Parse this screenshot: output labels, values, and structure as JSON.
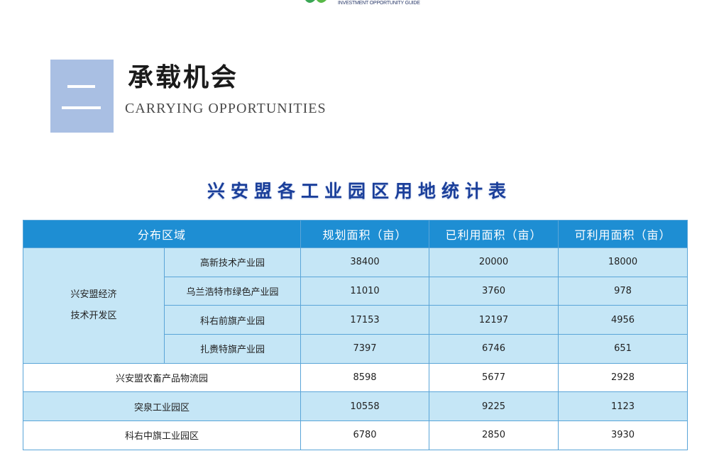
{
  "header": {
    "guide_text": "INVESTMENT OPPORTUNITY GUIDE"
  },
  "section": {
    "title": "承载机会",
    "subtitle": "CARRYING OPPORTUNITIES"
  },
  "table": {
    "title": "兴安盟各工业园区用地统计表",
    "headers": [
      "分布区域",
      "规划面积（亩）",
      "已利用面积（亩）",
      "可利用面积（亩）"
    ],
    "group": {
      "line1": "兴安盟经济",
      "line2": "技术开发区",
      "rows": [
        {
          "name": "高新技术产业园",
          "planned": "38400",
          "used": "20000",
          "available": "18000"
        },
        {
          "name": "乌兰浩特市绿色产业园",
          "planned": "11010",
          "used": "3760",
          "available": "978"
        },
        {
          "name": "科右前旗产业园",
          "planned": "17153",
          "used": "12197",
          "available": "4956"
        },
        {
          "name": "扎赉特旗产业园",
          "planned": "7397",
          "used": "6746",
          "available": "651"
        }
      ]
    },
    "rows": [
      {
        "name": "兴安盟农畜产品物流园",
        "planned": "8598",
        "used": "5677",
        "available": "2928"
      },
      {
        "name": "突泉工业园区",
        "planned": "10558",
        "used": "9225",
        "available": "1123"
      },
      {
        "name": "科右中旗工业园区",
        "planned": "6780",
        "used": "2850",
        "available": "3930"
      }
    ]
  },
  "colors": {
    "header_bg": "#1e8ed3",
    "row_blue": "#c5e6f6",
    "section_box": "#a9bfe3",
    "title_blue": "#1b3f9a"
  }
}
